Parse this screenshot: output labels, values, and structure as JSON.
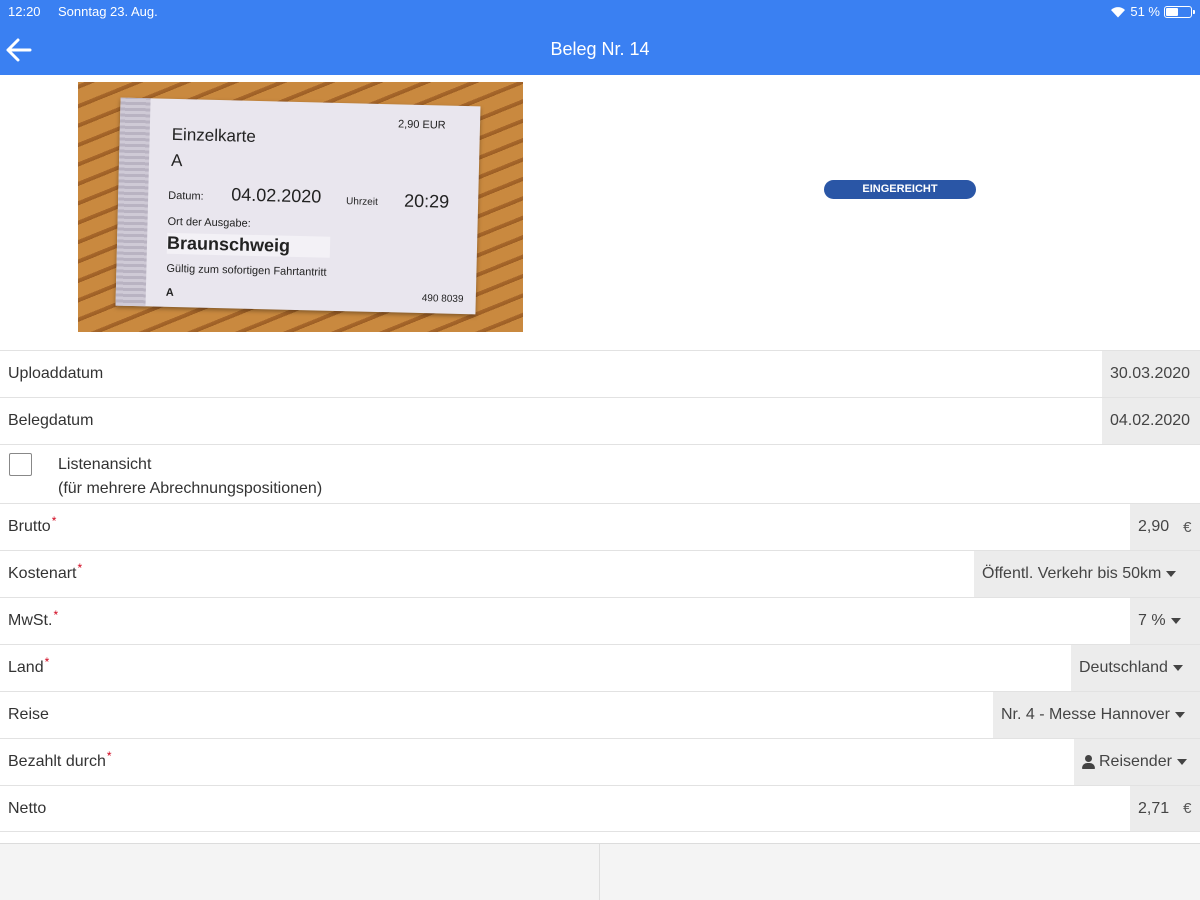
{
  "status_bar": {
    "time": "12:20",
    "date": "Sonntag 23. Aug.",
    "battery_text": "51 %",
    "battery_level": 0.51
  },
  "nav": {
    "title": "Beleg Nr. 14"
  },
  "receipt_photo": {
    "price": "2,90 EUR",
    "ticket_type": "Einzelkarte",
    "zone": "A",
    "date_label": "Datum:",
    "date": "04.02.2020",
    "time_label": "Uhrzeit",
    "time": "20:29",
    "place_label": "Ort der Ausgabe:",
    "place": "Braunschweig",
    "validity": "Gültig zum sofortigen Fahrtantritt",
    "zone_bottom": "A",
    "serial": "490 8039"
  },
  "status_badge": "EINGEREICHT",
  "fields": {
    "uploaddatum": {
      "label": "Uploaddatum",
      "value": "30.03.2020"
    },
    "belegdatum": {
      "label": "Belegdatum",
      "value": "04.02.2020"
    },
    "listenansicht": {
      "label": "Listenansicht",
      "sublabel": "(für mehrere Abrechnungspositionen)",
      "checked": false
    },
    "brutto": {
      "label": "Brutto",
      "required": "*",
      "value": "2,90",
      "unit": "€"
    },
    "kostenart": {
      "label": "Kostenart",
      "required": "*",
      "value": "Öffentl. Verkehr bis 50km"
    },
    "mwst": {
      "label": "MwSt.",
      "required": "*",
      "value": "7 %"
    },
    "land": {
      "label": "Land",
      "required": "*",
      "value": "Deutschland"
    },
    "reise": {
      "label": "Reise",
      "value": "Nr. 4 - Messe Hannover"
    },
    "bezahlt_durch": {
      "label": "Bezahlt durch",
      "required": "*",
      "value": "Reisender"
    },
    "netto": {
      "label": "Netto",
      "value": "2,71",
      "unit": "€"
    }
  },
  "colors": {
    "primary": "#3a80f2",
    "badge": "#2a56a6",
    "required": "#d0021b"
  }
}
